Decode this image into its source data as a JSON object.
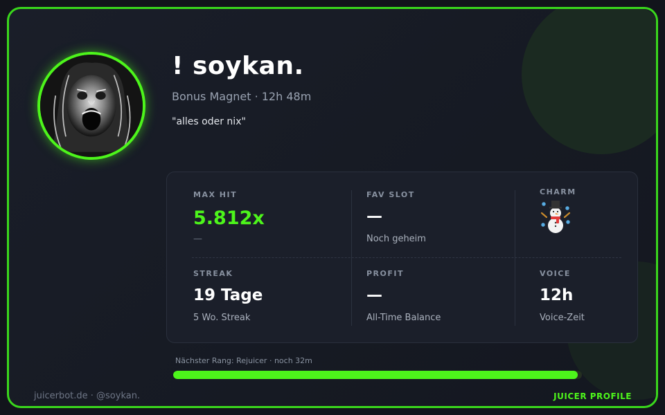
{
  "profile": {
    "name": "! soykan.",
    "role_line": "Bonus Magnet · 12h 48m",
    "quote": "\"alles oder nix\""
  },
  "stats": {
    "max_hit": {
      "label": "MAX HIT",
      "value": "5.812x",
      "sub": "—"
    },
    "fav_slot": {
      "label": "FAV SLOT",
      "value": "—",
      "sub": "Noch geheim"
    },
    "charm": {
      "label": "CHARM",
      "icon": "snowman-icon"
    },
    "streak": {
      "label": "STREAK",
      "value": "19 Tage",
      "sub": "5 Wo. Streak"
    },
    "profit": {
      "label": "PROFIT",
      "value": "—",
      "sub": "All-Time Balance"
    },
    "voice": {
      "label": "VOICE",
      "value": "12h",
      "sub": "Voice-Zeit"
    }
  },
  "progress": {
    "label": "Nächster Rang: Rejuicer · noch 32m",
    "fraction": 0.99
  },
  "footer": {
    "left": "juicerbot.de · @soykan.",
    "right": "JUICER PROFILE"
  },
  "colors": {
    "accent": "#4df51b",
    "border": "#3ad81c",
    "background": "#12141b"
  }
}
